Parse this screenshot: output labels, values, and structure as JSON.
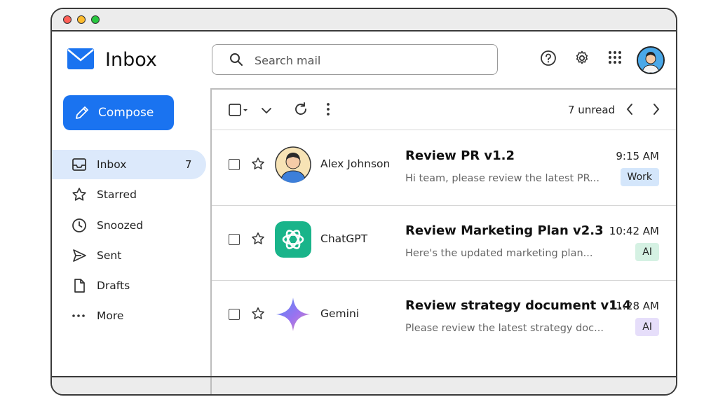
{
  "app": {
    "title": "Inbox"
  },
  "search": {
    "placeholder": "Search mail"
  },
  "compose": {
    "label": "Compose"
  },
  "sidebar": {
    "items": [
      {
        "label": "Inbox",
        "count": "7",
        "icon": "inbox-icon",
        "active": true
      },
      {
        "label": "Starred",
        "icon": "star-icon"
      },
      {
        "label": "Snoozed",
        "icon": "clock-icon"
      },
      {
        "label": "Sent",
        "icon": "send-icon"
      },
      {
        "label": "Drafts",
        "icon": "draft-icon"
      },
      {
        "label": "More",
        "icon": "more-dots-icon"
      }
    ]
  },
  "toolbar": {
    "unread": "7 unread"
  },
  "emails": [
    {
      "sender": "Alex Johnson",
      "subject": "Review PR v1.2",
      "preview": "Hi team, please review the latest PR...",
      "time": "9:15 AM",
      "tag": "Work",
      "tag_color": "#d4e6fb",
      "avatar": "person-avatar"
    },
    {
      "sender": "ChatGPT",
      "subject": "Review Marketing Plan v2.3",
      "preview": "Here's the updated marketing plan...",
      "time": "10:42 AM",
      "tag": "AI",
      "tag_color": "#d5f1e3",
      "avatar": "chatgpt-logo"
    },
    {
      "sender": "Gemini",
      "subject": "Review strategy document v1.4",
      "preview": "Please review the latest strategy doc...",
      "time": "11:28 AM",
      "tag": "AI",
      "tag_color": "#e6defa",
      "avatar": "gemini-logo"
    }
  ],
  "colors": {
    "accent": "#1a73f0",
    "active_nav": "#dce9fb"
  }
}
